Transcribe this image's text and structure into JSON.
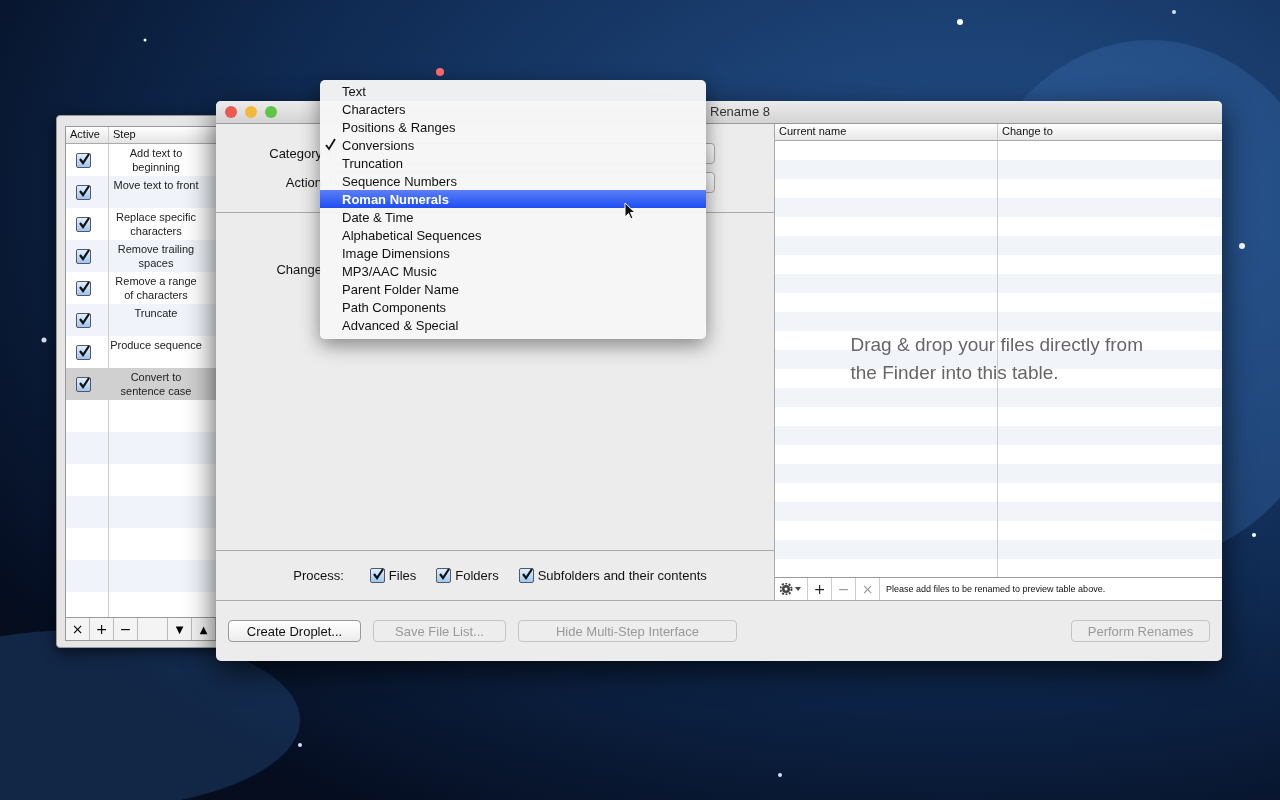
{
  "steps_panel": {
    "columns": [
      "Active",
      "Step"
    ],
    "steps": [
      {
        "label": "Add text to beginning",
        "checked": true,
        "selected": false
      },
      {
        "label": "Move text to front",
        "checked": true,
        "selected": false
      },
      {
        "label": "Replace specific characters",
        "checked": true,
        "selected": false
      },
      {
        "label": "Remove trailing spaces",
        "checked": true,
        "selected": false
      },
      {
        "label": "Remove a range of characters",
        "checked": true,
        "selected": false
      },
      {
        "label": "Truncate",
        "checked": true,
        "selected": false
      },
      {
        "label": "Produce sequence",
        "checked": true,
        "selected": false
      },
      {
        "label": "Convert to sentence case",
        "checked": true,
        "selected": true
      }
    ],
    "toolbar": [
      "×",
      "+",
      "−",
      "▼",
      "▲"
    ]
  },
  "window": {
    "title": "Rename 8",
    "fields": [
      {
        "label": "Category"
      },
      {
        "label": "Action"
      }
    ],
    "change_label": "Change",
    "process": {
      "label": "Process:",
      "options": [
        {
          "label": "Files",
          "checked": true
        },
        {
          "label": "Folders",
          "checked": true
        },
        {
          "label": "Subfolders and their contents",
          "checked": true
        }
      ]
    },
    "table": {
      "columns": [
        "Current name",
        "Change to"
      ],
      "hint": "Drag & drop your files directly from the Finder into this table."
    },
    "table_toolbar": {
      "buttons": [
        "+",
        "−",
        "×"
      ],
      "status": "Please add files to be renamed to preview table above."
    },
    "buttons": [
      {
        "label": "Create Droplet...",
        "disabled": false
      },
      {
        "label": "Save File List...",
        "disabled": true
      },
      {
        "label": "Hide Multi-Step Interface",
        "disabled": true
      },
      {
        "label": "Perform Renames",
        "disabled": true
      }
    ]
  },
  "category_menu": {
    "items": [
      {
        "label": "Text",
        "checked": false,
        "highlighted": false
      },
      {
        "label": "Characters",
        "checked": false,
        "highlighted": false
      },
      {
        "label": "Positions & Ranges",
        "checked": false,
        "highlighted": false
      },
      {
        "label": "Conversions",
        "checked": true,
        "highlighted": false
      },
      {
        "label": "Truncation",
        "checked": false,
        "highlighted": false
      },
      {
        "label": "Sequence Numbers",
        "checked": false,
        "highlighted": false
      },
      {
        "label": "Roman Numerals",
        "checked": false,
        "highlighted": true
      },
      {
        "label": "Date & Time",
        "checked": false,
        "highlighted": false
      },
      {
        "label": "Alphabetical Sequences",
        "checked": false,
        "highlighted": false
      },
      {
        "label": "Image Dimensions",
        "checked": false,
        "highlighted": false
      },
      {
        "label": "MP3/AAC Music",
        "checked": false,
        "highlighted": false
      },
      {
        "label": "Parent Folder Name",
        "checked": false,
        "highlighted": false
      },
      {
        "label": "Path Components",
        "checked": false,
        "highlighted": false
      },
      {
        "label": "Advanced & Special",
        "checked": false,
        "highlighted": false
      }
    ]
  }
}
